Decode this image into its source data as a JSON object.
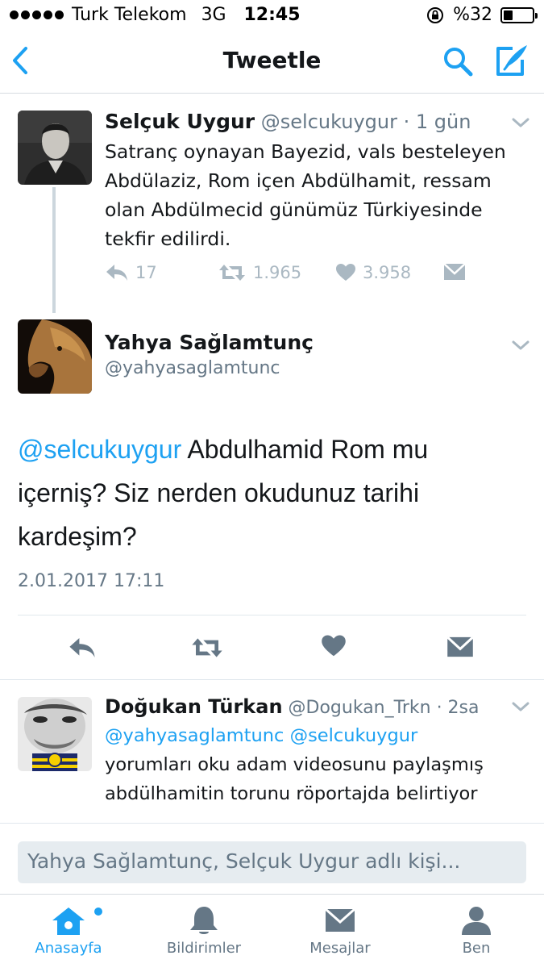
{
  "status_bar": {
    "carrier": "Turk Telekom",
    "network": "3G",
    "time": "12:45",
    "battery": "%32",
    "battery_level": 0.32
  },
  "nav": {
    "title": "Tweetle",
    "back_icon": "chevron-left-icon",
    "search_icon": "search-icon",
    "compose_icon": "compose-icon"
  },
  "tweets": [
    {
      "name": "Selçuk Uygur",
      "handle": "@selcukuygur",
      "time": "· 1 gün",
      "text": "Satranç oynayan Bayezid, vals besteleyen Abdülaziz, Rom içen Abdülhamit, ressam olan Abdülmecid günümüz Türkiyesinde tekfir edilirdi.",
      "replies": "17",
      "retweets": "1.965",
      "likes": "3.958"
    },
    {
      "name": "Yahya Sağlamtunç",
      "handle": "@yahyasaglamtunc",
      "mention": "@selcukuygur",
      "text": " Abdulhamid Rom mu içerniş? Siz nerden okudunuz tarihi kardeşim?",
      "timestamp": "2.01.2017 17:11"
    },
    {
      "name": "Doğukan Türkan",
      "handle": "@Dogukan_Trkn",
      "time": "· 2sa",
      "mentions": "@yahyasaglamtunc @selcukuygur",
      "text": "yorumları oku adam videosunu paylaşmış abdülhamitin torunu röportajda belirtiyor"
    }
  ],
  "reply_bar": {
    "placeholder": "Yahya Sağlamtunç, Selçuk Uygur adlı kişi..."
  },
  "tab_bar": {
    "tabs": [
      {
        "label": "Anasayfa",
        "icon": "home-icon",
        "active": true
      },
      {
        "label": "Bildirimler",
        "icon": "bell-icon",
        "active": false
      },
      {
        "label": "Mesajlar",
        "icon": "envelope-icon",
        "active": false
      },
      {
        "label": "Ben",
        "icon": "person-icon",
        "active": false
      }
    ]
  },
  "colors": {
    "accent": "#1da1f2",
    "text": "#14171a",
    "muted": "#657786",
    "icon_grey": "#aab8c2"
  }
}
